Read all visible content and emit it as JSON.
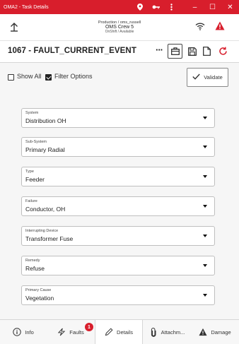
{
  "window": {
    "title": "OMA2 - Task Details",
    "controls": {
      "minimize": "–",
      "maximize": "☐",
      "close": "✕"
    },
    "status_icons": [
      "location-icon",
      "key-icon",
      "menu-icon"
    ]
  },
  "header": {
    "back_icon": "back-arrow-icon",
    "user_line": "Production / oms_russell",
    "crew": "OMS Crew 5",
    "status": "OnShift / Available",
    "icons": [
      "wifi-icon",
      "warning-icon"
    ]
  },
  "task": {
    "title": "1067 - FAULT_CURRENT_EVENT",
    "more_label": "···",
    "toolbar_icons": [
      "briefcase-icon",
      "save-icon",
      "document-icon",
      "refresh-icon"
    ]
  },
  "options": {
    "show_all": {
      "label": "Show All",
      "checked": false
    },
    "filter_options": {
      "label": "Filter Options",
      "checked": true
    },
    "validate_label": "Validate"
  },
  "fields": [
    {
      "label": "System",
      "value": "Distribution OH"
    },
    {
      "label": "Sub-System",
      "value": "Primary Radial"
    },
    {
      "label": "Type",
      "value": "Feeder"
    },
    {
      "label": "Failure",
      "value": "Conductor, OH"
    },
    {
      "label": "Interrupting Device",
      "value": "Transformer Fuse"
    },
    {
      "label": "Remedy",
      "value": "Refuse"
    },
    {
      "label": "Primary Cause",
      "value": "Vegetation"
    }
  ],
  "tabs": [
    {
      "label": "Info",
      "icon": "info-icon"
    },
    {
      "label": "Faults",
      "icon": "lightning-icon",
      "badge": "1"
    },
    {
      "label": "Details",
      "icon": "pencil-icon",
      "active": true
    },
    {
      "label": "Attachm...",
      "icon": "paperclip-icon"
    },
    {
      "label": "Damage",
      "icon": "warning-icon"
    }
  ],
  "colors": {
    "brand_red": "#d81e2c",
    "panel_bg": "#f6f6f6",
    "border": "#bfbfbf"
  }
}
